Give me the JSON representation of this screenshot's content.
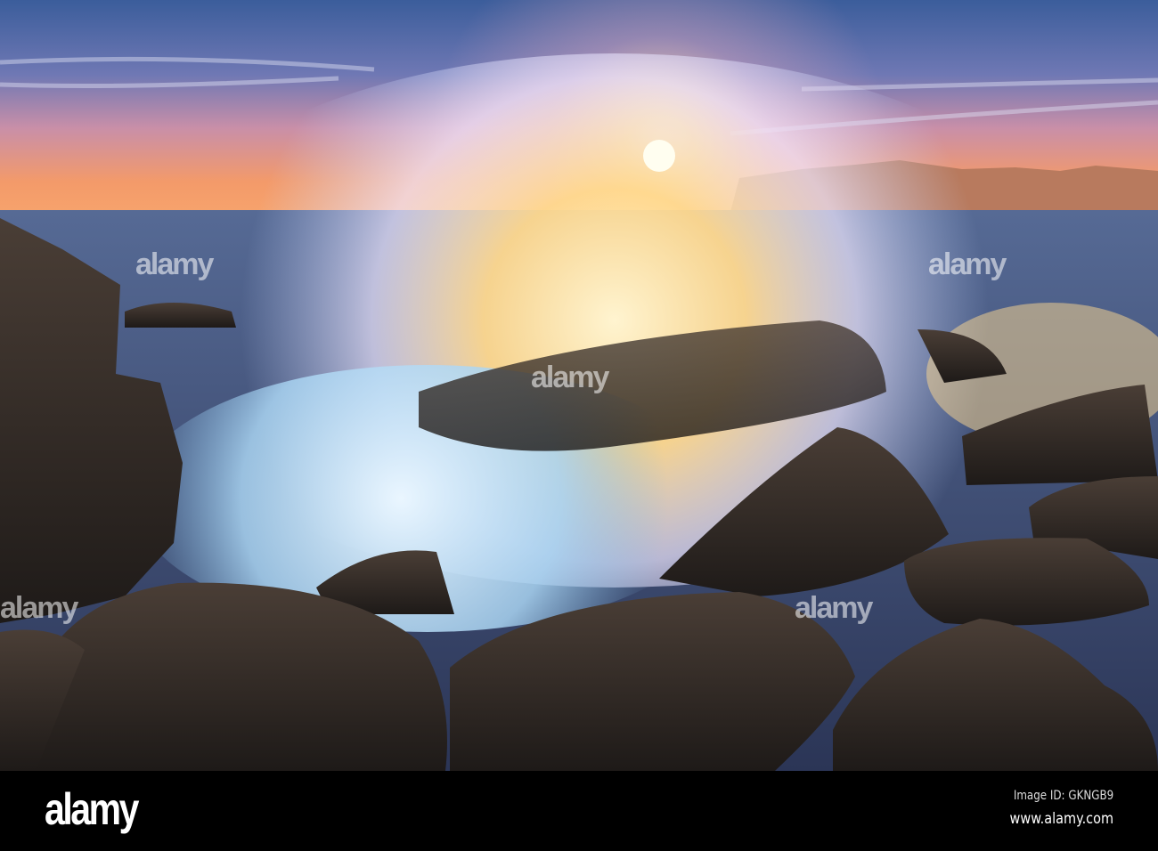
{
  "photo": {
    "subject": "wave-splash-over-rocks-at-sunset",
    "colors": {
      "sky_top": "#3d5f9c",
      "sky_mid": "#b58ab8",
      "horizon": "#f59a62",
      "sea": "#3c4a6e",
      "rock": "#2a2421",
      "spray_glow": "#ffd27a"
    }
  },
  "watermark": {
    "text": "alamy"
  },
  "footer": {
    "logo": "alamy",
    "image_id": "Image ID: GKNGB9",
    "url": "www.alamy.com"
  }
}
